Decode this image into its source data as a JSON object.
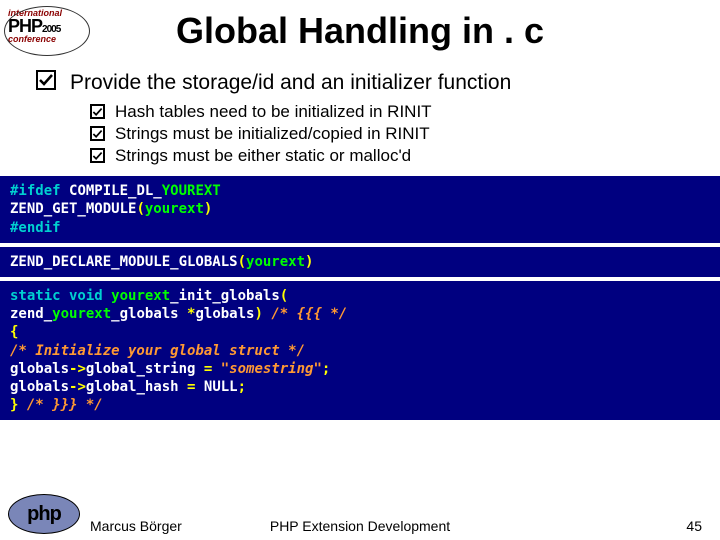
{
  "title": "Global Handling in . c",
  "main_bullet": "Provide the storage/id and an initializer function",
  "sub_bullets": [
    "Hash tables need to be initialized in RINIT",
    "Strings must be initialized/copied in RINIT",
    "Strings must be either static or malloc'd"
  ],
  "code1": {
    "l1a": "#ifdef",
    "l1b": "COMPILE_DL_",
    "l1c": "YOUREXT",
    "l2a": "ZEND_GET_MODULE",
    "l2b": "(",
    "l2c": "yourext",
    "l2d": ")",
    "l3": "#endif"
  },
  "code2": {
    "l1a": "ZEND_DECLARE_MODULE_GLOBALS",
    "l1b": "(",
    "l1c": "yourext",
    "l1d": ")"
  },
  "code3": {
    "l1a": "static void",
    "l1b": "yourext",
    "l1c": "_init_globals",
    "l1d": "(",
    "l2a": "        zend_",
    "l2b": "yourext",
    "l2c": "_globals ",
    "l2d": "*",
    "l2e": "globals",
    "l2f": ") ",
    "l2g": "/* {{{ */",
    "l3": "{",
    "l4": "      /* Initialize your global struct */",
    "l5a": "      globals",
    "l5b": "->",
    "l5c": "global_string ",
    "l5d": "= ",
    "l5e": "\"somestring\"",
    "l5f": ";",
    "l6a": "      globals",
    "l6b": "->",
    "l6c": "global_hash ",
    "l6d": "= ",
    "l6e": "NULL",
    "l6f": ";",
    "l7a": "} ",
    "l7b": "/* }}} */"
  },
  "footer": {
    "author": "Marcus Börger",
    "topic": "PHP Extension Development",
    "page": "45"
  }
}
